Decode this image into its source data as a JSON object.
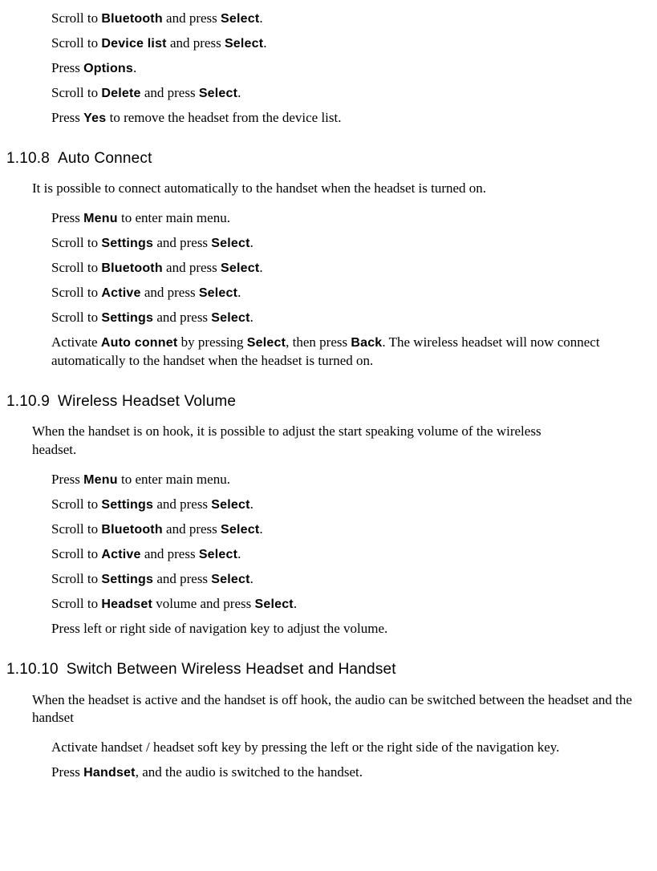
{
  "preSteps": {
    "s1_a": "Scroll to ",
    "s1_b": "Bluetooth",
    "s1_c": " and press ",
    "s1_d": "Select",
    "s1_e": ".",
    "s2_a": "Scroll to ",
    "s2_b": "Device list",
    "s2_c": " and press ",
    "s2_d": "Select",
    "s2_e": ".",
    "s3_a": "Press ",
    "s3_b": "Options",
    "s3_c": ".",
    "s4_a": "Scroll to ",
    "s4_b": "Delete",
    "s4_c": " and press ",
    "s4_d": "Select",
    "s4_e": ".",
    "s5_a": "Press ",
    "s5_b": "Yes",
    "s5_c": " to remove the headset from the device list."
  },
  "sec8": {
    "num": "1.10.8",
    "title": "Auto Connect",
    "para": "It is possible to connect automatically to the handset when the headset is turned on.",
    "s1_a": "Press ",
    "s1_b": "Menu",
    "s1_c": " to enter main menu.",
    "s2_a": "Scroll to ",
    "s2_b": "Settings",
    "s2_c": " and press ",
    "s2_d": "Select",
    "s2_e": ".",
    "s3_a": "Scroll to ",
    "s3_b": "Bluetooth",
    "s3_c": " and press ",
    "s3_d": "Select",
    "s3_e": ".",
    "s4_a": "Scroll to ",
    "s4_b": "Active",
    "s4_c": " and press ",
    "s4_d": "Select",
    "s4_e": ".",
    "s5_a": "Scroll to ",
    "s5_b": "Settings",
    "s5_c": " and press ",
    "s5_d": "Select",
    "s5_e": ".",
    "s6_a": "Activate ",
    "s6_b": "Auto connet",
    "s6_c": " by pressing ",
    "s6_d": "Select",
    "s6_e": ", then press ",
    "s6_f": "Back",
    "s6_g": ". The wireless headset will now connect automatically to the handset when the headset is turned on."
  },
  "sec9": {
    "num": "1.10.9",
    "title": "Wireless Headset Volume",
    "para": "When the handset is on hook, it is possible to adjust the start speaking volume of the wireless headset.",
    "s1_a": "Press ",
    "s1_b": "Menu",
    "s1_c": " to enter main menu.",
    "s2_a": "Scroll to ",
    "s2_b": "Settings",
    "s2_c": " and press ",
    "s2_d": "Select",
    "s2_e": ".",
    "s3_a": "Scroll to ",
    "s3_b": "Bluetooth",
    "s3_c": " and press ",
    "s3_d": "Select",
    "s3_e": ".",
    "s4_a": "Scroll to ",
    "s4_b": "Active",
    "s4_c": " and press ",
    "s4_d": "Select",
    "s4_e": ".",
    "s5_a": "Scroll to ",
    "s5_b": "Settings",
    "s5_c": " and press ",
    "s5_d": "Select",
    "s5_e": ".",
    "s6_a": "Scroll to ",
    "s6_b": "Headset",
    "s6_c": " volume and press ",
    "s6_d": "Select",
    "s6_e": ".",
    "s7": "Press left or right side of navigation key to adjust the volume."
  },
  "sec10": {
    "num": "1.10.10",
    "title": "Switch Between Wireless Headset and Handset",
    "para": "When the headset is active and the handset is off hook, the audio can be switched between the headset and the handset",
    "s1": "Activate handset / headset soft key by pressing the left or the right side of the navigation key.",
    "s2_a": "Press ",
    "s2_b": "Handset",
    "s2_c": ", and the audio is switched to the handset."
  }
}
